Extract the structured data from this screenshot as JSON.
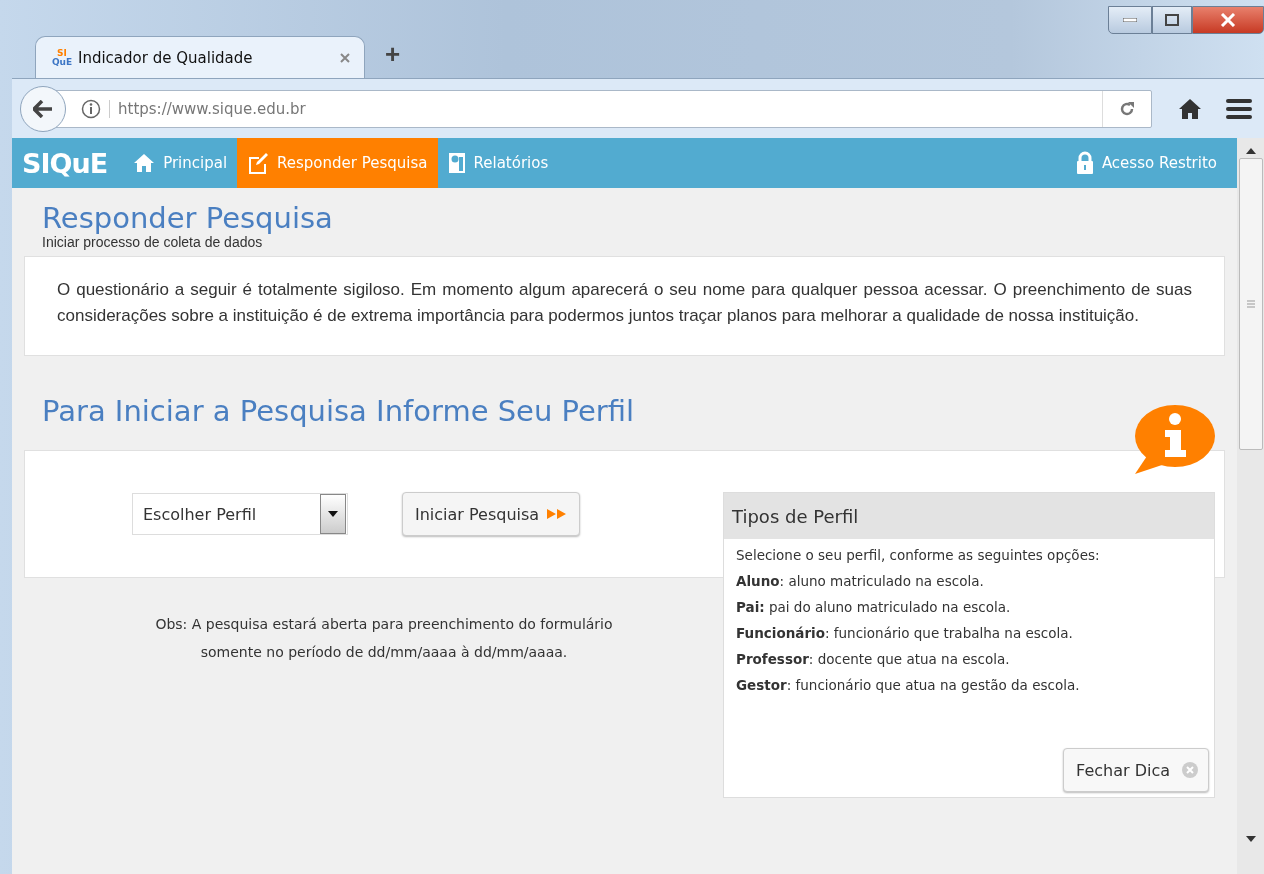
{
  "browser": {
    "tabs": [
      {
        "title": "Indicador de Qualidade",
        "favicon_top": "SI",
        "favicon_bottom": "QuE",
        "selected": true
      }
    ],
    "new_tab": "+",
    "url": "https://www.sique.edu.br"
  },
  "nav": {
    "logo": "SIQuE",
    "items": [
      {
        "label": "Principal",
        "selected": false
      },
      {
        "label": "Responder Pesquisa",
        "selected": true
      },
      {
        "label": "Relatórios",
        "selected": false
      }
    ],
    "restricted": "Acesso Restrito"
  },
  "header": {
    "title": "Responder Pesquisa",
    "subtitle": "Iniciar processo de coleta de dados"
  },
  "intro": "O questionário a seguir é totalmente sigiloso. Em momento algum aparecerá o seu nome para qualquer pessoa acessar. O preenchimento de suas considerações sobre a instituição é de extrema importância para podermos juntos traçar planos para melhorar a qualidade de nossa instituição.",
  "profile": {
    "heading": "Para Iniciar a Pesquisa Informe Seu Perfil",
    "select": {
      "value": "Escolher Perfil"
    },
    "start_button": "Iniciar Pesquisa",
    "note": [
      "Obs: A pesquisa estará aberta para preenchimento do formulário",
      "somente no período de dd/mm/aaaa à dd/mm/aaaa."
    ]
  },
  "tip": {
    "title": "Tipos de Perfil",
    "intro": "Selecione o seu perfil, conforme as seguintes opções:",
    "items": [
      "**Aluno**: aluno matriculado na escola.",
      "**Pai:** pai do aluno matriculado na escola.",
      "**Funcionário**: funcionário que trabalha na escola.",
      "**Professor**: docente que atua na escola.",
      "**Gestor**: funcionário que atua na gestão da escola."
    ],
    "close_button": "Fechar Dica"
  }
}
